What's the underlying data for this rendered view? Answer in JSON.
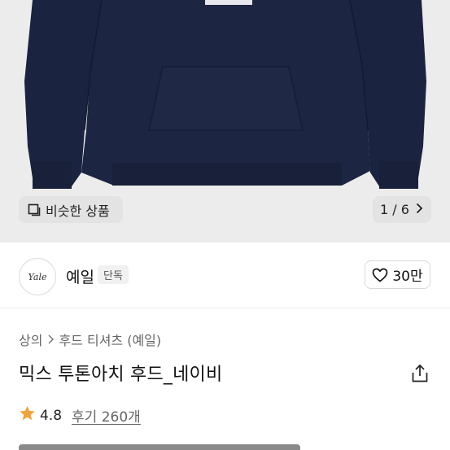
{
  "hero": {
    "similar_label": "비슷한 상품",
    "counter": "1 / 6"
  },
  "brand": {
    "logo_text": "Yale",
    "name": "예일",
    "badge": "단독",
    "likes": "30만"
  },
  "product": {
    "breadcrumb": [
      "상의",
      "후드 티셔츠 (예일)"
    ],
    "title": "믹스 투톤아치 후드_네이비",
    "rating": "4.8",
    "reviews": "후기 260개"
  },
  "colors": {
    "hoodie": "#1c2541",
    "star": "#f2a33a"
  }
}
